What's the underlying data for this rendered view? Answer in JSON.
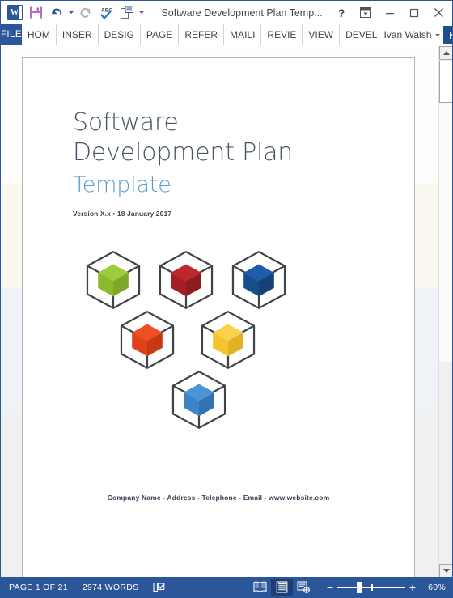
{
  "window": {
    "document_title": "Software Development Plan Temp...",
    "quick_access": [
      {
        "name": "word-app-icon",
        "label": "W"
      },
      {
        "name": "save-icon",
        "label": "Save"
      },
      {
        "name": "undo-icon",
        "label": "Undo"
      },
      {
        "name": "redo-icon",
        "label": "Redo"
      },
      {
        "name": "spelling-grammar-icon",
        "label": "ABC"
      },
      {
        "name": "print-preview-icon",
        "label": "Print Preview"
      },
      {
        "name": "customize-qat-icon",
        "label": "Customize Quick Access Toolbar"
      }
    ],
    "controls": {
      "help": "?",
      "ribbon_display_options": "Ribbon Display Options",
      "minimize": "Minimize",
      "maximize": "Maximize",
      "close": "Close"
    }
  },
  "ribbon": {
    "file_tab": "FILE",
    "tabs": [
      "HOM",
      "INSER",
      "DESIG",
      "PAGE",
      "REFER",
      "MAILI",
      "REVIE",
      "VIEW",
      "DEVEL"
    ],
    "user_name": "Ivan Walsh",
    "avatar_initial": "K"
  },
  "document": {
    "title_line1": "Software",
    "title_line2": "Development Plan",
    "subtitle": "Template",
    "version_line": "Version X.x • 18 January 2017",
    "footer": "Company Name - Address - Telephone - Email - www.website.com",
    "cubes": [
      {
        "name": "cube-green",
        "top": "#9ECB3B",
        "left": "#8CBA2E",
        "right": "#7FA82A"
      },
      {
        "name": "cube-darkred",
        "top": "#C0272D",
        "left": "#A41F25",
        "right": "#8E1B20"
      },
      {
        "name": "cube-blue",
        "top": "#1C5EA8",
        "left": "#164E8C",
        "right": "#124276"
      },
      {
        "name": "cube-orange",
        "top": "#F04E23",
        "left": "#E2401A",
        "right": "#C73815"
      },
      {
        "name": "cube-yellow",
        "top": "#FBD14B",
        "left": "#F5C32E",
        "right": "#E3B125"
      },
      {
        "name": "cube-lightblue",
        "top": "#4A95D8",
        "left": "#3C84C6",
        "right": "#3274B0"
      }
    ],
    "wireframe_color": "#3f4448"
  },
  "statusbar": {
    "page_indicator": "PAGE 1 OF 21",
    "word_count": "2974 WORDS",
    "proofing_icon": "proofing-errors-icon",
    "views": [
      {
        "name": "read-mode-view-button",
        "label": "Read Mode",
        "active": false
      },
      {
        "name": "print-layout-view-button",
        "label": "Print Layout",
        "active": true
      },
      {
        "name": "web-layout-view-button",
        "label": "Web Layout",
        "active": false
      }
    ],
    "zoom_out": "−",
    "zoom_in": "+",
    "zoom_level": "60%"
  },
  "colors": {
    "word_blue": "#2b579a",
    "title_gray": "#4a5568",
    "subtitle_blue": "#5b9bd5"
  }
}
